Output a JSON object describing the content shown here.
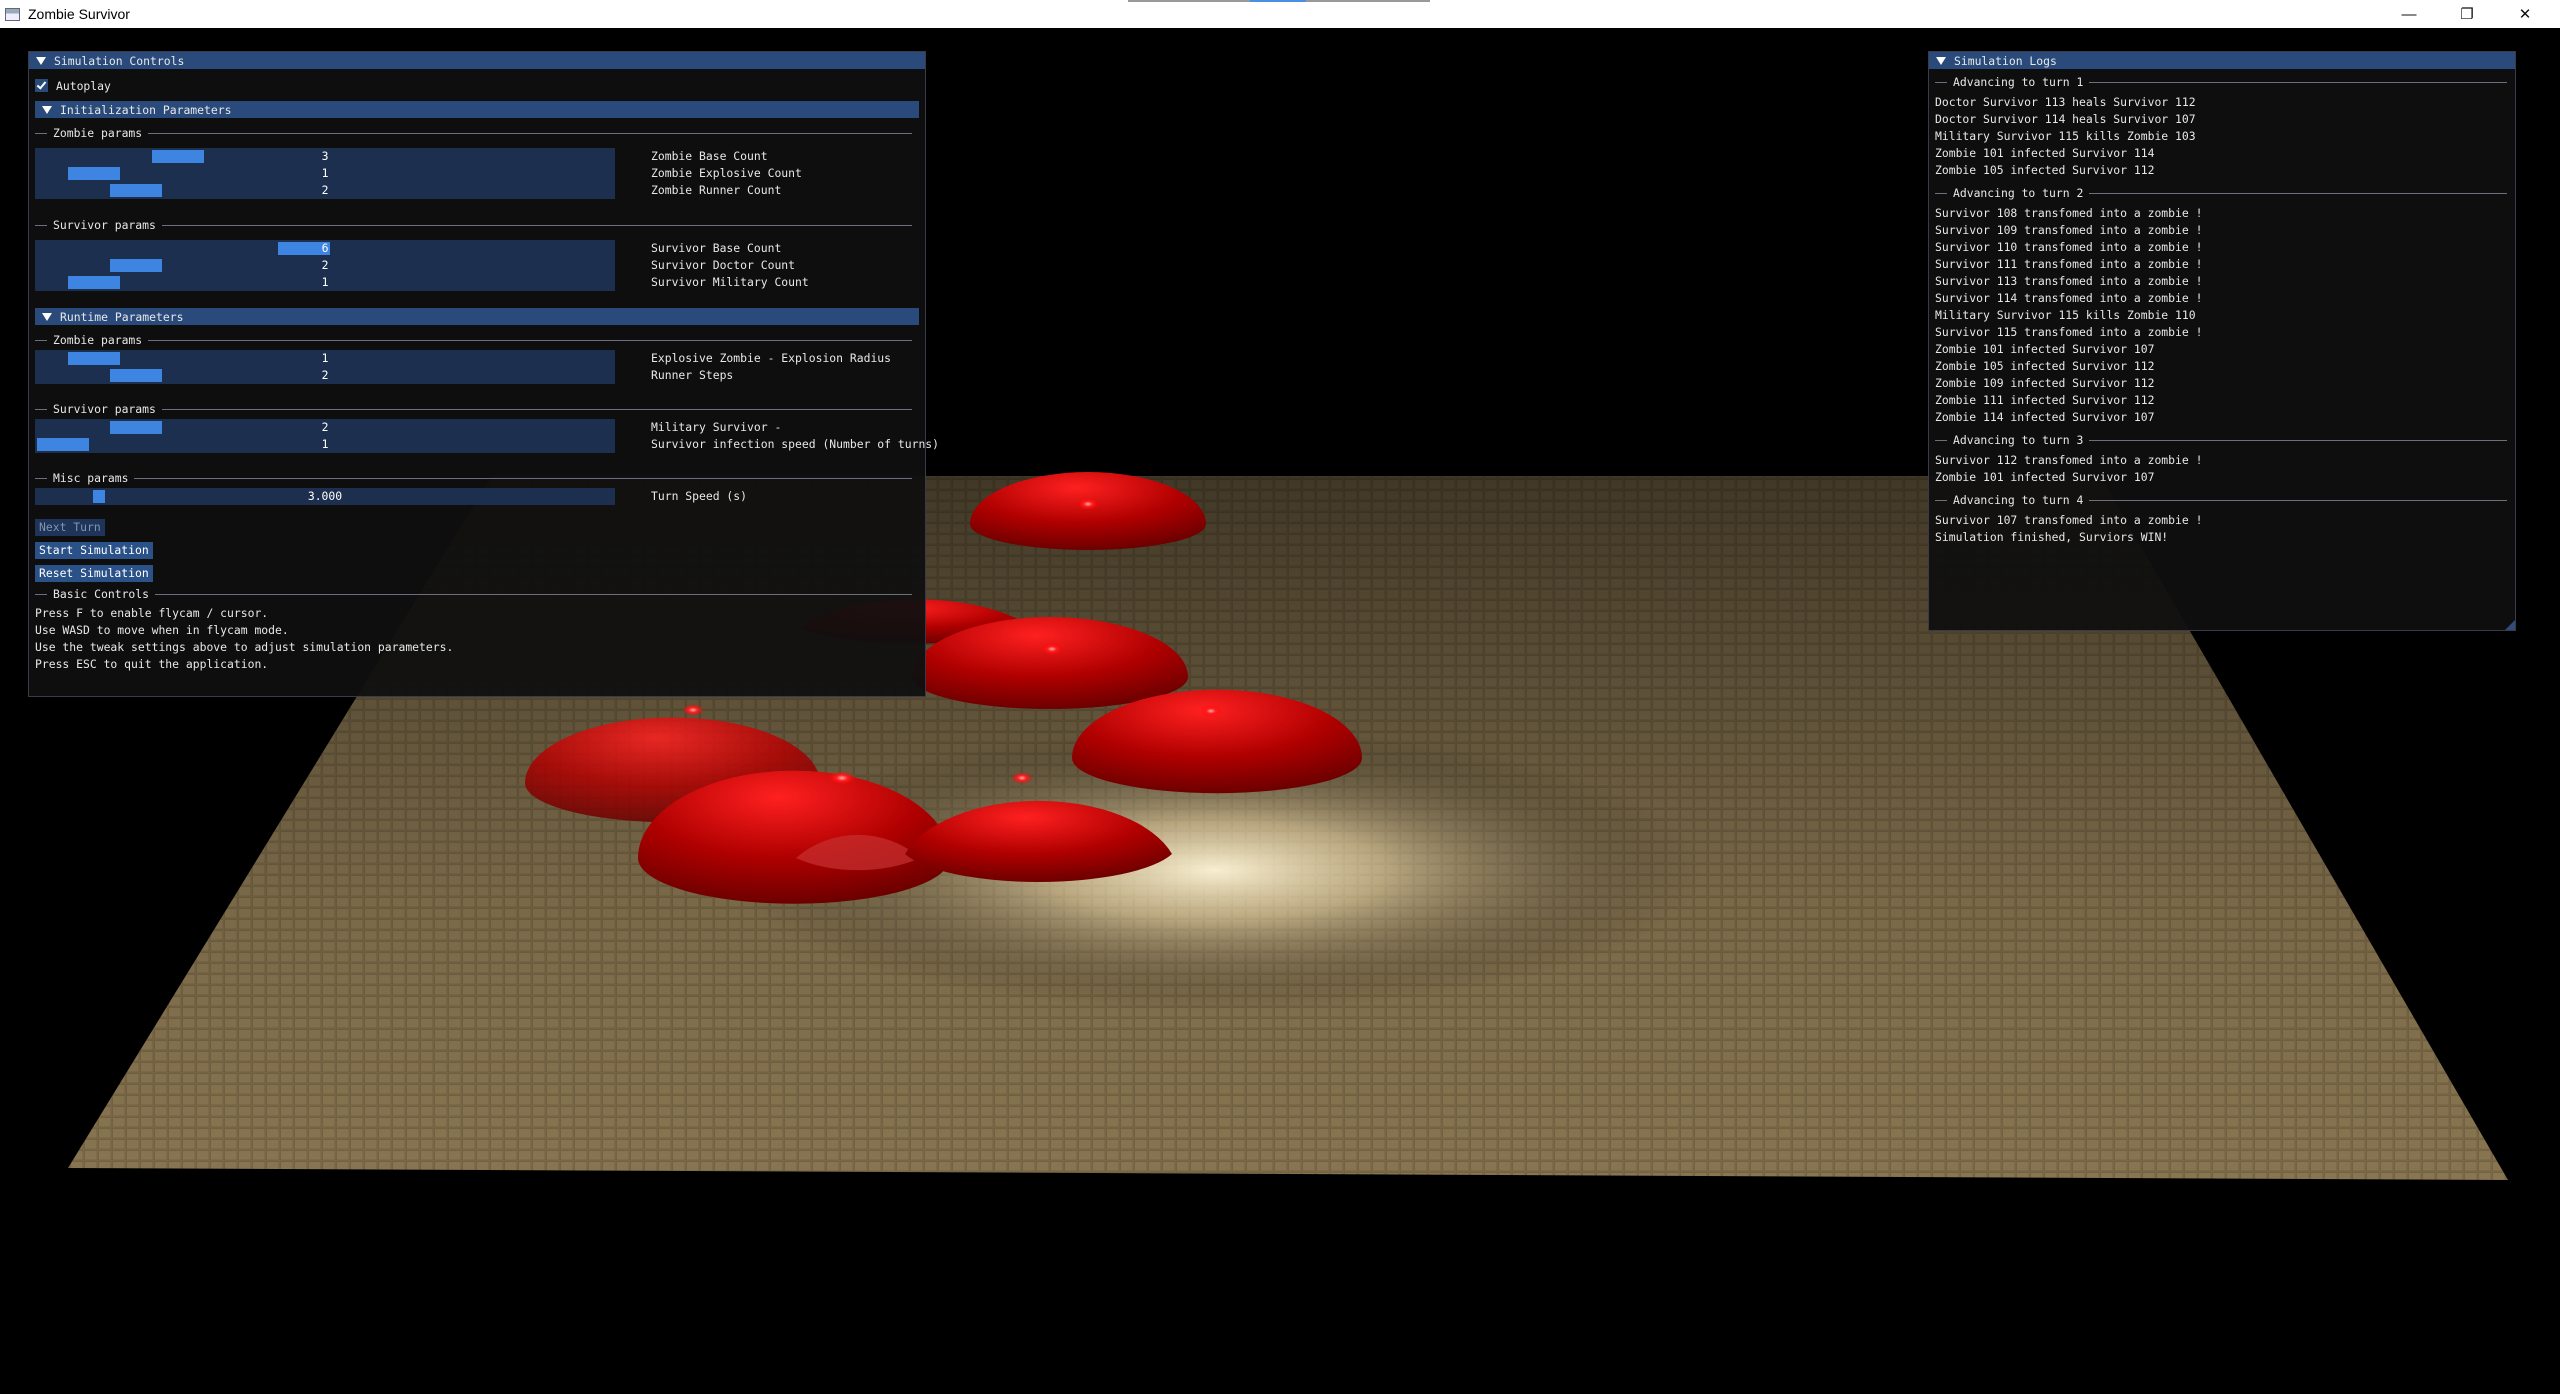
{
  "window": {
    "title": "Zombie Survivor",
    "minimize": "—",
    "restore": "❐",
    "close": "✕"
  },
  "controls": {
    "title": "Simulation Controls",
    "autoplay_label": "Autoplay",
    "init_header": "Initialization Parameters",
    "zombie_params": "Zombie params",
    "survivor_params": "Survivor params",
    "runtime_header": "Runtime Parameters",
    "misc_params": "Misc params",
    "basic_controls": "Basic Controls",
    "sliders": [
      {
        "value": "3",
        "label": "Zombie Base Count",
        "fraction": 0.22
      },
      {
        "value": "1",
        "label": "Zombie Explosive Count",
        "fraction": 0.06
      },
      {
        "value": "2",
        "label": "Zombie Runner Count",
        "fraction": 0.14
      },
      {
        "value": "6",
        "label": "Survivor Base Count",
        "fraction": 0.46
      },
      {
        "value": "2",
        "label": "Survivor Doctor Count",
        "fraction": 0.14
      },
      {
        "value": "1",
        "label": "Survivor Military Count",
        "fraction": 0.06
      },
      {
        "value": "1",
        "label": "Explosive Zombie - Explosion Radius",
        "fraction": 0.06
      },
      {
        "value": "2",
        "label": "Runner Steps",
        "fraction": 0.14
      },
      {
        "value": "2",
        "label": "Military Survivor -",
        "fraction": 0.14
      },
      {
        "value": "1",
        "label": "Survivor infection speed (Number of turns)",
        "fraction": 0.0
      },
      {
        "value": "3.000",
        "label": "Turn Speed (s)",
        "fraction": 0.1
      }
    ],
    "next_turn": "Next Turn",
    "start": "Start Simulation",
    "reset": "Reset Simulation",
    "help": [
      "Press F to enable flycam / cursor.",
      "Use WASD to move when in flycam mode.",
      "Use the tweak settings above to adjust simulation parameters.",
      "Press ESC to quit the application."
    ]
  },
  "logs": {
    "title": "Simulation Logs",
    "turns": [
      {
        "label": "Advancing to turn 1",
        "lines": [
          "Doctor Survivor 113 heals Survivor 112",
          "Doctor Survivor 114 heals Survivor 107",
          "Military Survivor 115 kills Zombie 103",
          "Zombie 101 infected Survivor 114",
          "Zombie 105 infected Survivor 112"
        ]
      },
      {
        "label": "Advancing to turn 2",
        "lines": [
          "Survivor 108 transfomed into a zombie !",
          "Survivor 109 transfomed into a zombie !",
          "Survivor 110 transfomed into a zombie !",
          "Survivor 111 transfomed into a zombie !",
          "Survivor 113 transfomed into a zombie !",
          "Survivor 114 transfomed into a zombie !",
          "Military Survivor 115 kills Zombie 110",
          "Survivor 115 transfomed into a zombie !",
          "Zombie 101 infected Survivor 107",
          "Zombie 105 infected Survivor 112",
          "Zombie 109 infected Survivor 112",
          "Zombie 111 infected Survivor 112",
          "Zombie 114 infected Survivor 107"
        ]
      },
      {
        "label": "Advancing to turn 3",
        "lines": [
          "Survivor 112 transfomed into a zombie !",
          "Zombie 101 infected Survivor 107"
        ]
      },
      {
        "label": "Advancing to turn 4",
        "lines": [
          "Survivor 107 transfomed into a zombie !",
          "Simulation finished, Surviors WIN!"
        ]
      }
    ]
  },
  "colors": {
    "header": "#294a7a",
    "slider_grab": "#3d85e0",
    "zombie": "#b30000",
    "floor": "#8a7650"
  }
}
